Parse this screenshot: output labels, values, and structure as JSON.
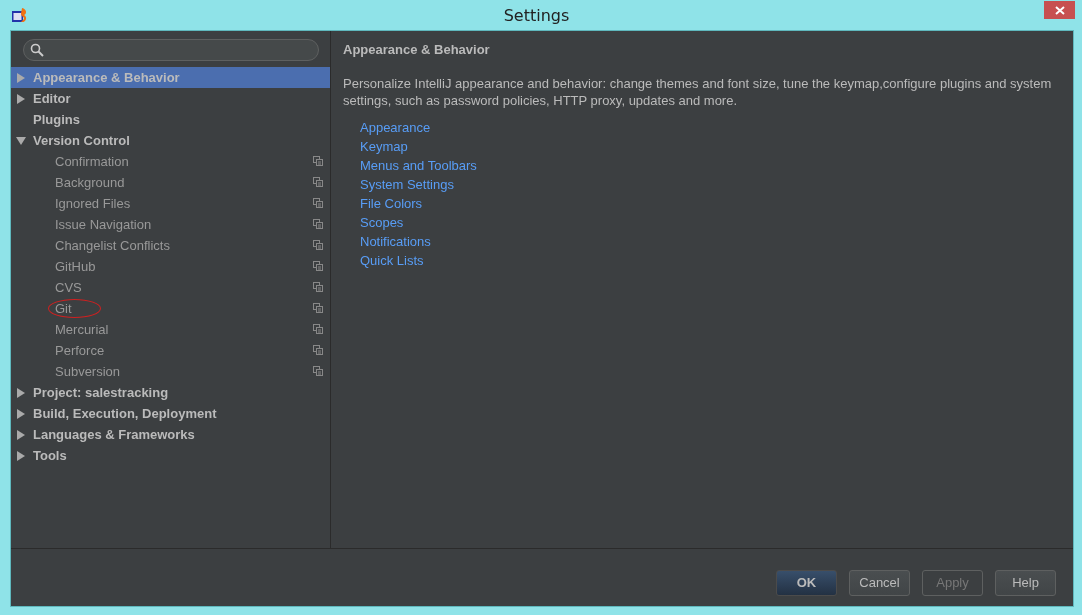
{
  "window": {
    "title": "Settings"
  },
  "tree": [
    {
      "label": "Appearance & Behavior",
      "selected": true,
      "expanded": false,
      "kind": "group"
    },
    {
      "label": "Editor",
      "selected": false,
      "expanded": false,
      "kind": "group"
    },
    {
      "label": "Plugins",
      "selected": false,
      "kind": "leaf"
    },
    {
      "label": "Version Control",
      "selected": false,
      "expanded": true,
      "kind": "group",
      "children": [
        {
          "label": "Confirmation",
          "selected": false,
          "circled": false
        },
        {
          "label": "Background",
          "selected": false,
          "circled": false
        },
        {
          "label": "Ignored Files",
          "selected": false,
          "circled": false
        },
        {
          "label": "Issue Navigation",
          "selected": false,
          "circled": false
        },
        {
          "label": "Changelist Conflicts",
          "selected": false,
          "circled": false
        },
        {
          "label": "GitHub",
          "selected": false,
          "circled": false
        },
        {
          "label": "CVS",
          "selected": false,
          "circled": false
        },
        {
          "label": "Git",
          "selected": false,
          "circled": true
        },
        {
          "label": "Mercurial",
          "selected": false,
          "circled": false
        },
        {
          "label": "Perforce",
          "selected": false,
          "circled": false
        },
        {
          "label": "Subversion",
          "selected": false,
          "circled": false
        }
      ]
    },
    {
      "label": "Project: salestracking",
      "selected": false,
      "expanded": false,
      "kind": "group"
    },
    {
      "label": "Build, Execution, Deployment",
      "selected": false,
      "expanded": false,
      "kind": "group"
    },
    {
      "label": "Languages & Frameworks",
      "selected": false,
      "expanded": false,
      "kind": "group"
    },
    {
      "label": "Tools",
      "selected": false,
      "expanded": false,
      "kind": "group"
    }
  ],
  "content": {
    "heading": "Appearance & Behavior",
    "description": "Personalize IntelliJ appearance and behavior: change themes and font size, tune the keymap,configure plugins and system settings, such as password policies, HTTP proxy, updates and more.",
    "links": [
      "Appearance",
      "Keymap",
      "Menus and Toolbars",
      "System Settings",
      "File Colors",
      "Scopes",
      "Notifications",
      "Quick Lists"
    ]
  },
  "buttons": [
    {
      "label": "OK",
      "kind": "default",
      "disabled": false
    },
    {
      "label": "Cancel",
      "kind": "normal",
      "disabled": false
    },
    {
      "label": "Apply",
      "kind": "normal",
      "disabled": true
    },
    {
      "label": "Help",
      "kind": "normal",
      "disabled": false
    }
  ]
}
